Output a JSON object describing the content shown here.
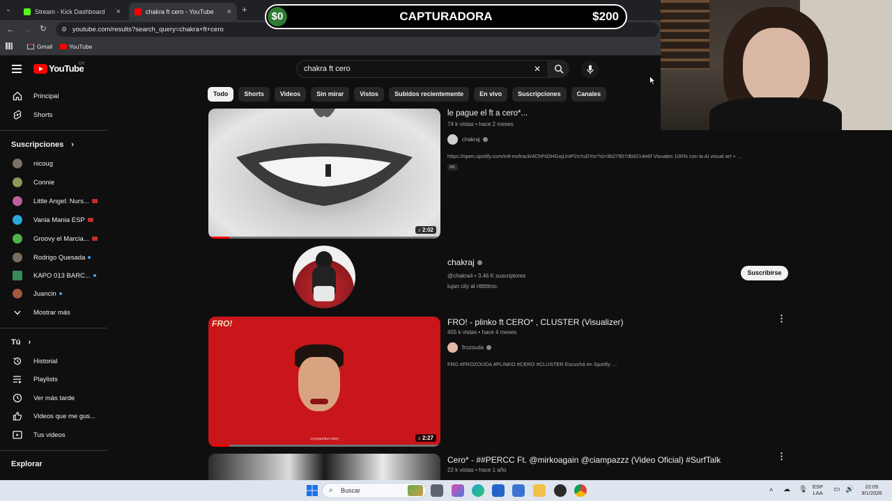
{
  "browser": {
    "tabs": [
      {
        "label": "Stream - Kick Dashboard",
        "close": "×"
      },
      {
        "label": "chakra ft cero - YouTube",
        "close": "×"
      }
    ],
    "new_tab": "+",
    "url": "youtube.com/results?search_query=chakra+ft+cero",
    "bookmarks": [
      "Gmail",
      "YouTube"
    ]
  },
  "overlay": {
    "left": "$0",
    "title": "CAPTURADORA",
    "right": "$200"
  },
  "header": {
    "logo": "YouTube",
    "country": "UY",
    "search_value": "chakra ft cero",
    "clear_glyph": "✕"
  },
  "chips": [
    "Todo",
    "Shorts",
    "Videos",
    "Sin mirar",
    "Vistos",
    "Subidos recientemente",
    "En vivo",
    "Suscripciones",
    "Canales"
  ],
  "sidebar": {
    "main": [
      {
        "label": "Principal",
        "icon": "home-icon"
      },
      {
        "label": "Shorts",
        "icon": "shorts-icon"
      }
    ],
    "subs_header": "Suscripciones",
    "subs": [
      {
        "label": "nicoug",
        "color": "#7d6f63",
        "badge": "none"
      },
      {
        "label": "Connie",
        "color": "#8b9a5a",
        "badge": "none"
      },
      {
        "label": "Little Angel: Nurs...",
        "color": "#c05fa0",
        "badge": "live"
      },
      {
        "label": "Vania Mania ESP",
        "color": "#2aa9d6",
        "badge": "live"
      },
      {
        "label": "Groovy el Marcia...",
        "color": "#4fb24a",
        "badge": "live"
      },
      {
        "label": "Rodrigo Quesada",
        "color": "#7a6c60",
        "badge": "dot"
      },
      {
        "label": "KAPO 013 BARC...",
        "color": "#3a8a57",
        "badge": "dot"
      },
      {
        "label": "Juancin",
        "color": "#a05a3c",
        "badge": "dot"
      }
    ],
    "show_more": "Mostrar más",
    "you_header": "Tú",
    "you": [
      {
        "label": "Historial",
        "icon": "history-icon"
      },
      {
        "label": "Playlists",
        "icon": "playlists-icon"
      },
      {
        "label": "Ver más tarde",
        "icon": "clock-icon"
      },
      {
        "label": "Videos que me gus...",
        "icon": "thumbs-up-icon"
      },
      {
        "label": "Tus videos",
        "icon": "your-videos-icon"
      }
    ],
    "explore_header": "Explorar"
  },
  "results": [
    {
      "title": "le pague el ft a cero*...",
      "meta": "74 k vistas • hace 2 meses",
      "channel": "chakraj",
      "desc": "https://open.spotify.com/intl-es/track/4ChPd2HGojUniP2sYuDYor?si=3b27907db9214e6f Visuales 100% con la Ai visual art + ...",
      "badge": "4K",
      "duration": "2:02",
      "progress": 0.09
    },
    {
      "channel_name": "chakraj",
      "handle": "@chakra4 • 3.46 K suscriptores",
      "desc": "lujan city al rittttttmo.",
      "subscribe": "Suscribirse"
    },
    {
      "title": "FRO! - plinko ft CERO* , CLUSTER (Visualizer)",
      "meta": "455 k vistas • hace 4 meses",
      "channel": "frozouda",
      "desc": "FRO #FROZOUDA #PLINKO #CERO #CLUSTER Escuchá en Spotify: ...",
      "duration": "2:27",
      "logo": "FRO!",
      "caption": "si preguntas estoy",
      "progress": 0.09
    },
    {
      "title": "Cero* - ##PERCC Ft. @mirkoagain @ciampazzz (Video Oficial) #SurfTalk",
      "meta": "22 k vistas • hace 1 año"
    }
  ],
  "taskbar": {
    "search": "Buscar",
    "lang": [
      "ESP",
      "LAA"
    ],
    "time": "22:05",
    "date": "9/1/2026"
  },
  "colors": {
    "bg": "#0f0f0f",
    "accent": "#ff0000",
    "chip_selected": "#f1f1f1",
    "overlay_green": "#2f7a33"
  }
}
